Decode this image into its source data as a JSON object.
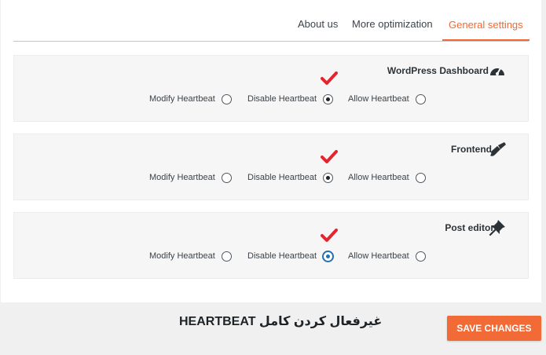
{
  "tabs": [
    {
      "label": "About us"
    },
    {
      "label": "More optimization"
    },
    {
      "label": "General settings",
      "active": true
    }
  ],
  "sections": [
    {
      "title": "WordPress Dashboard",
      "icon": "dashboard-gauge-icon",
      "options": [
        {
          "label": "Modify Heartbeat",
          "checked": false
        },
        {
          "label": "Disable Heartbeat",
          "checked": true
        },
        {
          "label": "Allow Heartbeat",
          "checked": false
        }
      ]
    },
    {
      "title": "Frontend",
      "icon": "paint-brush-icon",
      "options": [
        {
          "label": "Modify Heartbeat",
          "checked": false
        },
        {
          "label": "Disable Heartbeat",
          "checked": true
        },
        {
          "label": "Allow Heartbeat",
          "checked": false
        }
      ]
    },
    {
      "title": "Post editor",
      "icon": "pin-icon",
      "options": [
        {
          "label": "Modify Heartbeat",
          "checked": false
        },
        {
          "label": "Disable Heartbeat",
          "checked": true,
          "focused": true
        },
        {
          "label": "Allow Heartbeat",
          "checked": false
        }
      ]
    }
  ],
  "caption": "غیرفعال کردن کامل HEARTBEAT",
  "save_button": "SAVE CHANGES",
  "colors": {
    "accent": "#f26a36",
    "check": "#e3262d",
    "focus": "#2271b1"
  }
}
